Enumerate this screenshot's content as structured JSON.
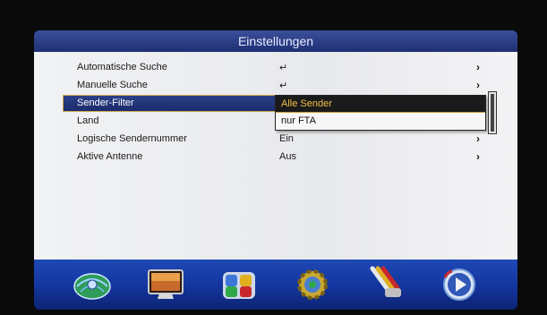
{
  "header": {
    "title": "Einstellungen"
  },
  "menu": {
    "rows": [
      {
        "label": "Automatische Suche",
        "value": "↵",
        "arrow": "›"
      },
      {
        "label": "Manuelle Suche",
        "value": "↵",
        "arrow": "›"
      },
      {
        "label": "Sender-Filter",
        "value": "",
        "arrow": ""
      },
      {
        "label": "Land",
        "value": "",
        "arrow": ""
      },
      {
        "label": "Logische Sendernummer",
        "value": "Ein",
        "arrow": "›"
      },
      {
        "label": "Aktive Antenne",
        "value": "Aus",
        "arrow": "›"
      }
    ]
  },
  "dropdown": {
    "options": [
      "Alle Sender",
      "nur FTA"
    ],
    "selected": "Alle Sender"
  },
  "icons": [
    "globe-satellite-icon",
    "tv-screen-icon",
    "puzzle-pieces-icon",
    "gear-icon",
    "av-cables-icon",
    "play-button-icon"
  ],
  "colors": {
    "title_bar": "#2a3c86",
    "highlight_text": "#f2c247",
    "icon_bar": "#1a3fa8"
  }
}
